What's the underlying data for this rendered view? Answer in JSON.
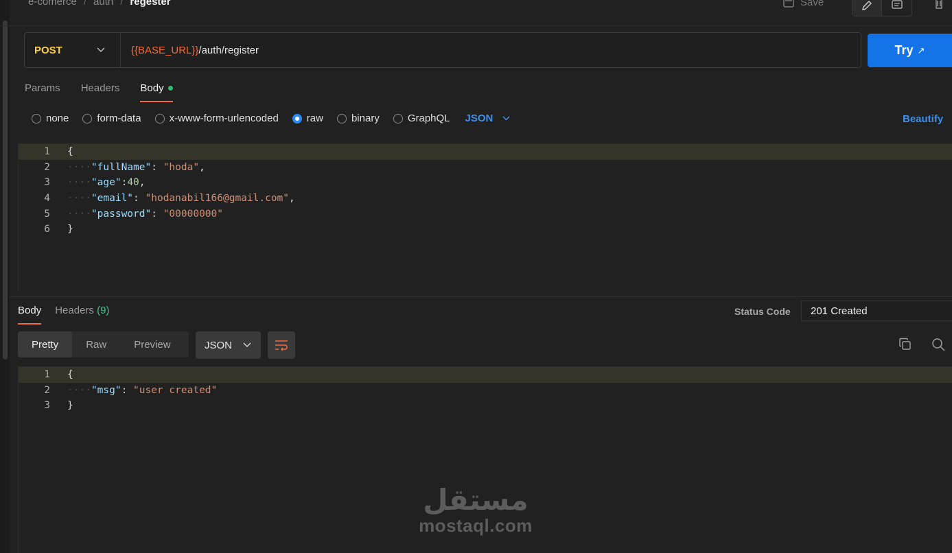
{
  "breadcrumb": {
    "items": [
      "e-comerce",
      "auth",
      "regester"
    ],
    "separator": "/"
  },
  "toolbar": {
    "save_label": "Save",
    "edit_icon": "pencil-icon",
    "comment_icon": "comment-icon",
    "delete_icon": "trash-icon"
  },
  "request": {
    "method": "POST",
    "url_variable": "{{BASE_URL}}",
    "url_path": "/auth/register",
    "send_label": "Try",
    "send_icon": "external-arrow-icon"
  },
  "request_tabs": {
    "params": "Params",
    "headers": "Headers",
    "body": "Body"
  },
  "body_types": {
    "none": "none",
    "form_data": "form-data",
    "urlencoded": "x-www-form-urlencoded",
    "raw": "raw",
    "binary": "binary",
    "graphql": "GraphQL",
    "selected": "raw",
    "format": "JSON",
    "beautify": "Beautify"
  },
  "request_body": {
    "line_numbers": [
      "1",
      "2",
      "3",
      "4",
      "5",
      "6"
    ],
    "lines": [
      "{",
      "    \"fullName\": \"hoda\",",
      "    \"age\":40,",
      "    \"email\": \"hodanabil166@gmail.com\",",
      "    \"password\": \"00000000\"",
      "}"
    ]
  },
  "response": {
    "tab_body": "Body",
    "tab_headers": "Headers",
    "headers_count": "(9)",
    "status_label": "Status Code",
    "status_value": "201 Created",
    "view_pretty": "Pretty",
    "view_raw": "Raw",
    "view_preview": "Preview",
    "format": "JSON",
    "line_numbers": [
      "1",
      "2",
      "3"
    ],
    "lines": [
      "{",
      "    \"msg\": \"user created\"",
      "}"
    ]
  },
  "watermark": {
    "logo": "مستقل",
    "text": "mostaql.com"
  },
  "colors": {
    "accent": "#f26b3a",
    "primary_button": "#1473e6",
    "method_post": "#ffd03d",
    "link_blue": "#3d8fe8",
    "success_green": "#4cc38a"
  }
}
